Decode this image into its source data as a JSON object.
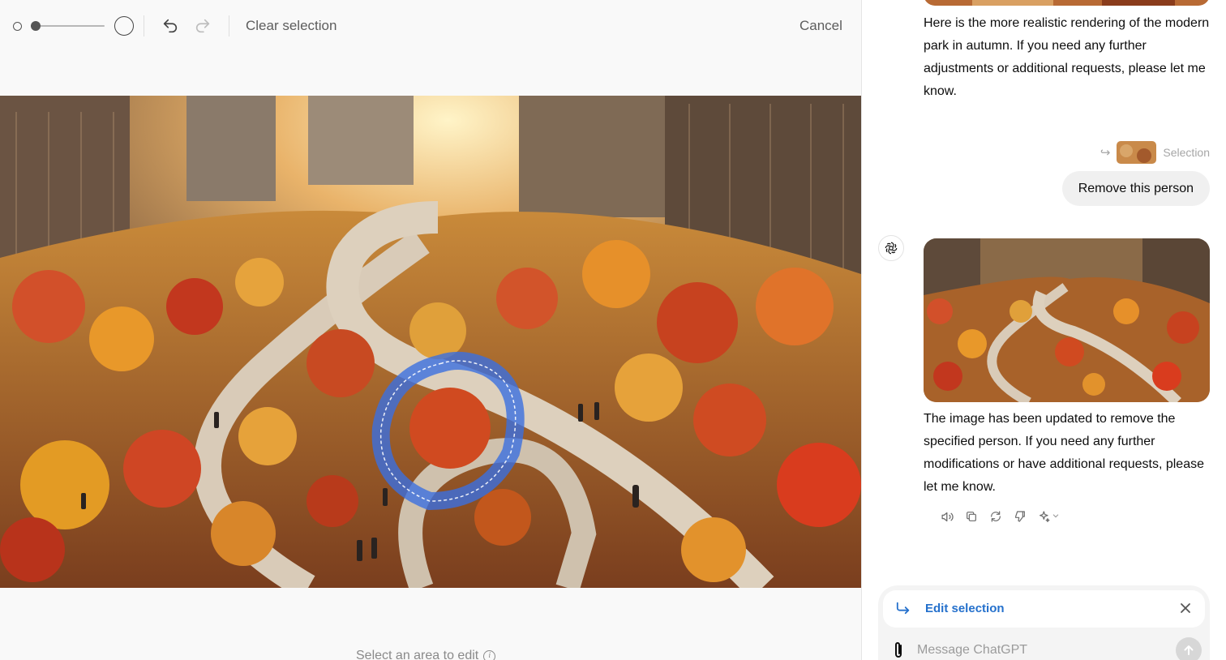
{
  "toolbar": {
    "brush_small_icon": "brush-size-small-icon",
    "brush_large_icon": "brush-size-large-icon",
    "brush_size_level": 0.07,
    "undo_icon": "undo-icon",
    "redo_icon": "redo-icon",
    "clear_selection_label": "Clear selection",
    "cancel_label": "Cancel"
  },
  "canvas": {
    "hint_text": "Select an area to edit",
    "hint_icon": "info-icon",
    "selection_color": "#3b6fe0"
  },
  "chat": {
    "assistant_message_1": "Here is the more realistic rendering of the modern park in autumn. If you need any further adjustments or additional requests, please let me know.",
    "selection_tag": "Selection",
    "user_message": "Remove this person",
    "assistant_message_2": "The image has been updated to remove the specified person. If you need any further modifications or have additional requests, please let me know.",
    "action_icons": [
      "read-aloud-icon",
      "copy-icon",
      "regenerate-icon",
      "thumbs-down-icon",
      "sparkle-icon"
    ]
  },
  "composer": {
    "edit_selection_label": "Edit selection",
    "placeholder": "Message ChatGPT"
  },
  "colors": {
    "accent_blue": "#2470cc",
    "background": "#f9f9f9",
    "bubble": "#f0f0f0"
  }
}
